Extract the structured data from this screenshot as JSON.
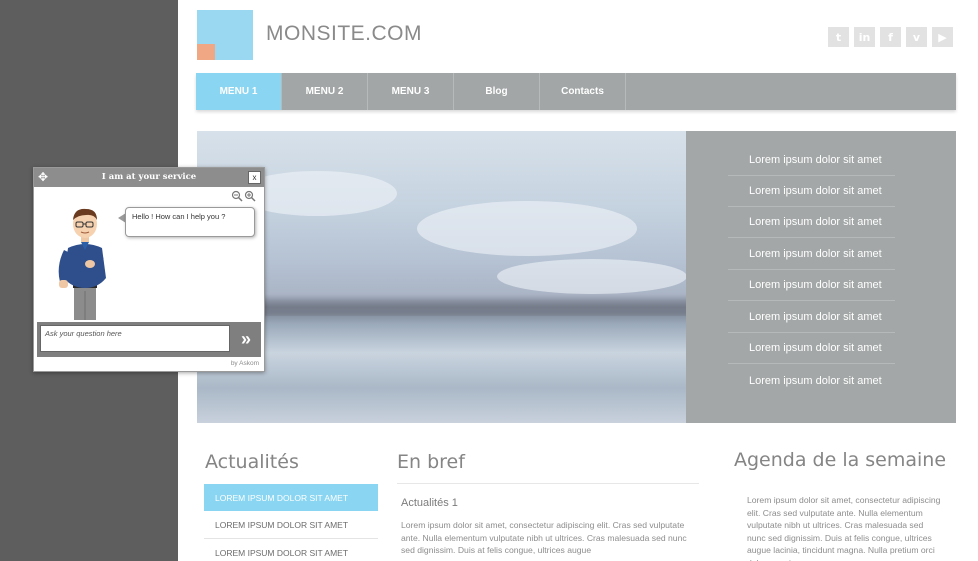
{
  "header": {
    "site_title": "MONSITE.COM"
  },
  "social": [
    {
      "icon": "twitter-icon",
      "glyph": "t"
    },
    {
      "icon": "linkedin-icon",
      "glyph": "in"
    },
    {
      "icon": "facebook-icon",
      "glyph": "f"
    },
    {
      "icon": "vimeo-icon",
      "glyph": "v"
    },
    {
      "icon": "youtube-icon",
      "glyph": "▶"
    }
  ],
  "nav": {
    "items": [
      "MENU 1",
      "MENU 2",
      "MENU 3",
      "Blog",
      "Contacts"
    ],
    "active": "MENU 1"
  },
  "side_list": [
    "Lorem ipsum dolor sit amet",
    "Lorem ipsum dolor sit amet",
    "Lorem ipsum dolor sit amet",
    "Lorem ipsum dolor sit amet",
    "Lorem ipsum dolor sit amet",
    "Lorem ipsum dolor sit amet",
    "Lorem ipsum dolor sit amet",
    "Lorem ipsum dolor sit amet"
  ],
  "actualites": {
    "title": "Actualités",
    "items": [
      "LOREM IPSUM DOLOR SIT AMET",
      "LOREM IPSUM DOLOR SIT AMET",
      "LOREM IPSUM DOLOR SIT AMET"
    ]
  },
  "en_bref": {
    "title": "En bref",
    "subtitle": "Actualités 1",
    "text": "Lorem ipsum dolor sit amet, consectetur adipiscing elit. Cras sed vulputate ante. Nulla elementum vulputate nibh ut ultrices. Cras malesuada sed nunc sed dignissim. Duis at felis congue, ultrices augue"
  },
  "agenda": {
    "title": "Agenda de la semaine",
    "text": "Lorem ipsum dolor sit amet, consectetur adipiscing elit. Cras sed vulputate ante. Nulla elementum vulputate nibh ut ultrices. Cras malesuada sed nunc sed dignissim. Duis at felis congue, ultrices augue lacinia, tincidunt magna. Nulla pretium orci dolor nec viverra"
  },
  "chat": {
    "title": "I am at your service",
    "close_label": "x",
    "bubble": "Hello ! How can I help you ?",
    "input_placeholder": "Ask your question here",
    "send_label": "»",
    "by": "by Askom"
  },
  "colors": {
    "accent": "#8ad5f2",
    "nav_bg": "#a2a6a6",
    "logo_blue": "#99d8f0",
    "logo_orange": "#f0a783"
  }
}
